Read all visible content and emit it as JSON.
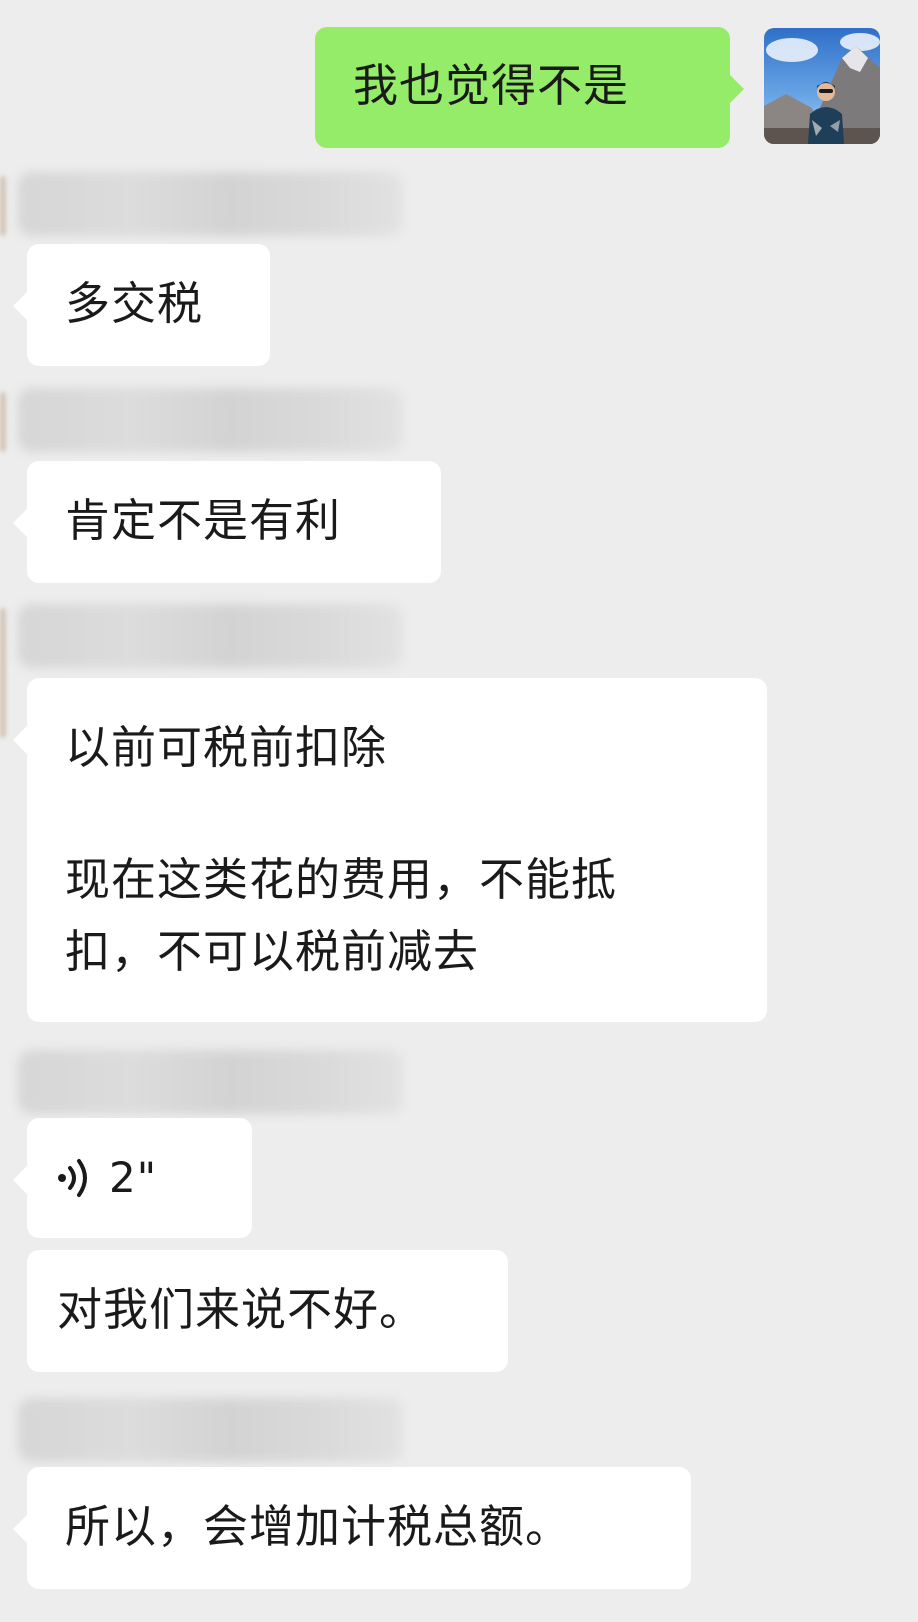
{
  "chat": {
    "outgoing": [
      {
        "text": "我也觉得不是"
      }
    ],
    "incoming": [
      {
        "text": "多交税"
      },
      {
        "text": "肯定不是有利"
      },
      {
        "line1": "以前可税前扣除",
        "line2": "现在这类花的费用，不能抵",
        "line3": "扣，不可以税前减去"
      },
      {
        "voice_duration": "2\""
      },
      {
        "text": "对我们来说不好。"
      },
      {
        "text": "所以，会增加计税总额。"
      }
    ]
  },
  "icons": {
    "voice": "voice-wave-icon",
    "avatar": "user-avatar-photo"
  },
  "colors": {
    "background": "#ededed",
    "outgoing_bubble": "#95ec69",
    "incoming_bubble": "#ffffff",
    "text": "#1a1a1a"
  }
}
